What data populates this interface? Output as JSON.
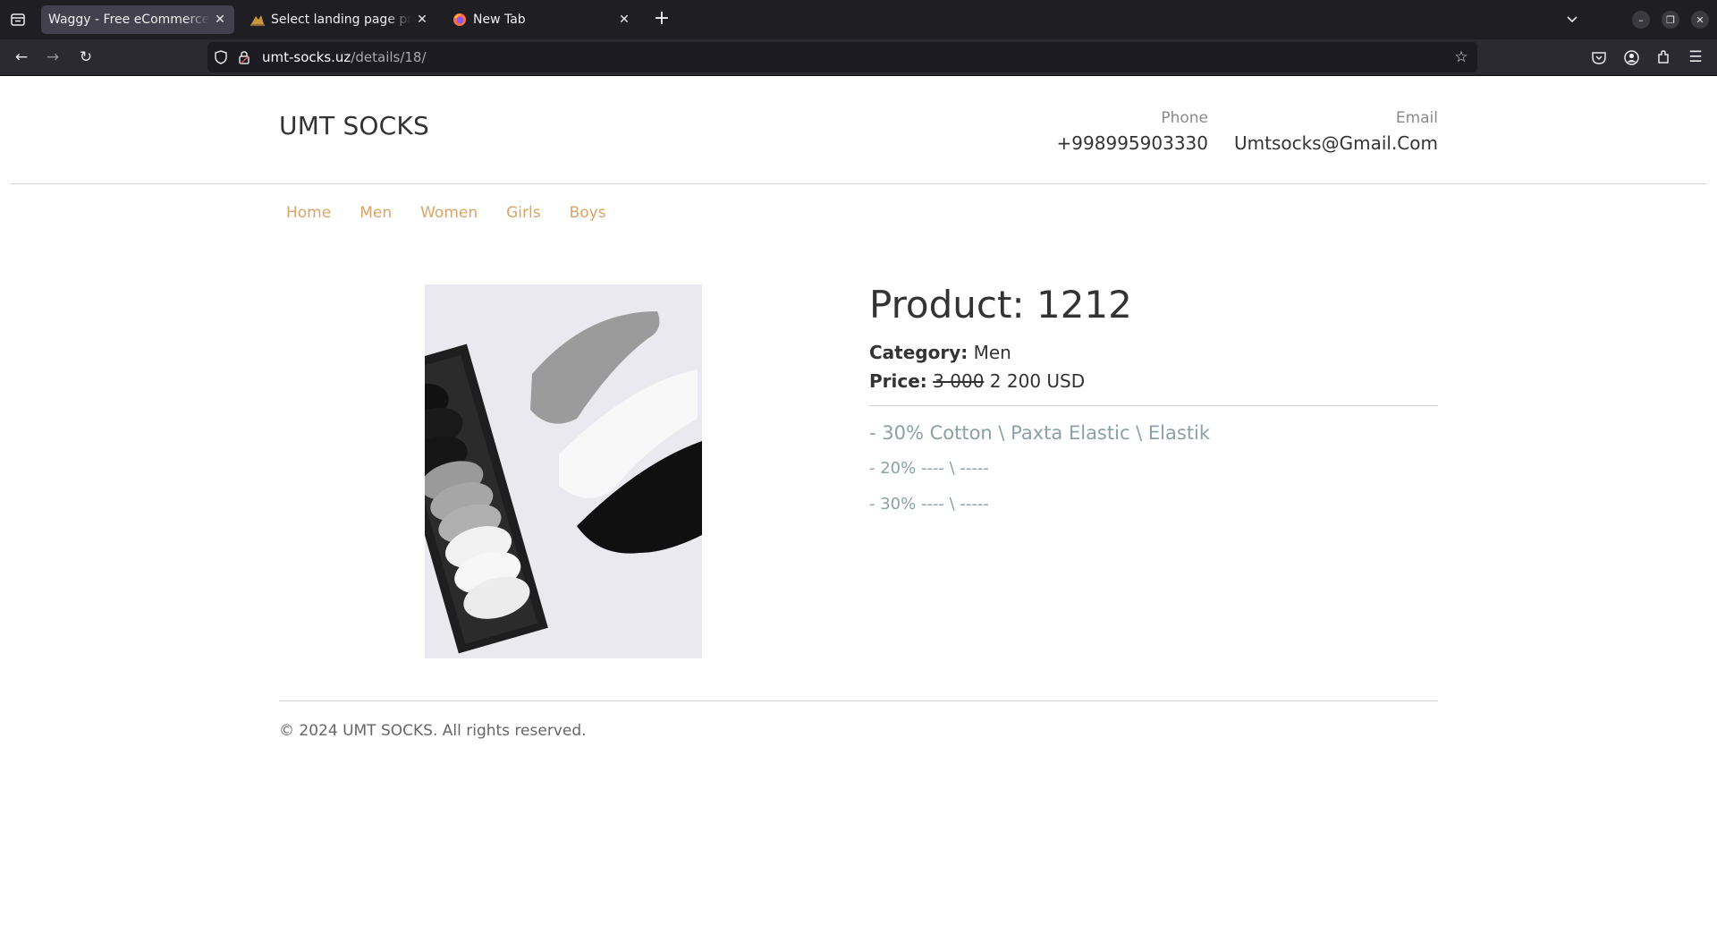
{
  "browser": {
    "tabs": [
      {
        "title": "Waggy - Free eCommerce Pe",
        "active": true,
        "favicon": "page-icon"
      },
      {
        "title": "Select landing page prod",
        "active": false,
        "favicon": "bird-icon"
      },
      {
        "title": "New Tab",
        "active": false,
        "favicon": "firefox-icon"
      }
    ],
    "url": {
      "domain": "umt-socks.uz",
      "path": "/details/18/"
    }
  },
  "site": {
    "brand": "UMT SOCKS",
    "phone_label": "Phone",
    "phone": "+998995903330",
    "email_label": "Email",
    "email": "Umtsocks@Gmail.Com",
    "nav": [
      "Home",
      "Men",
      "Women",
      "Girls",
      "Boys"
    ],
    "accent_color": "#d9a467"
  },
  "product": {
    "title": "Product: 1212",
    "category_label": "Category:",
    "category": "Men",
    "price_label": "Price:",
    "old_price": "3 000",
    "price": "2 200 USD",
    "specs": [
      "- 30% Cotton \\ Paxta Elastic \\ Elastik",
      "- 20% ---- \\ -----",
      "- 30% ---- \\ -----"
    ]
  },
  "footer": {
    "text": "© 2024 UMT SOCKS. All rights reserved."
  }
}
